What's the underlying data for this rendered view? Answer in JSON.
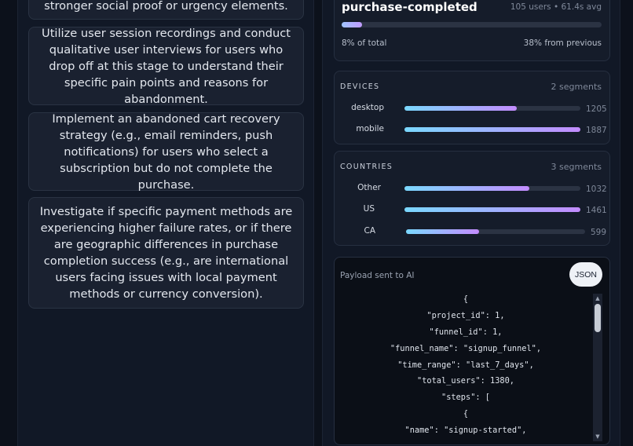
{
  "recommendations": [
    "stronger social proof or urgency elements.",
    "Utilize user session recordings and conduct qualitative user interviews for users who drop off at this stage to understand their specific pain points and reasons for abandonment.",
    "Implement an abandoned cart recovery strategy (e.g., email reminders, push notifications) for users who select a subscription but do not complete the purchase.",
    "Investigate if specific payment methods are experiencing higher failure rates, or if there are geographic differences in purchase completion success (e.g., are international users facing issues with local payment methods or currency conversion)."
  ],
  "step": {
    "name": "purchase-completed",
    "meta": "105 users • 61.4s avg",
    "progress": 0.08,
    "pct_of_total": "8% of total",
    "from_previous": "38% from previous"
  },
  "devices": {
    "title": "DEVICES",
    "count": "2 segments",
    "items": [
      {
        "label": "desktop",
        "value": "1205",
        "fill": 0.64
      },
      {
        "label": "mobile",
        "value": "1887",
        "fill": 1.0
      }
    ]
  },
  "countries": {
    "title": "COUNTRIES",
    "count": "3 segments",
    "items": [
      {
        "label": "Other",
        "value": "1032",
        "fill": 0.71
      },
      {
        "label": "US",
        "value": "1461",
        "fill": 1.0
      },
      {
        "label": "CA",
        "value": "599",
        "fill": 0.41
      }
    ]
  },
  "payload": {
    "label": "Payload sent to AI",
    "button": "JSON",
    "lines": [
      "{",
      "\"project_id\": 1,",
      "\"funnel_id\": 1,",
      "\"funnel_name\": \"signup_funnel\",",
      "\"time_range\": \"last_7_days\",",
      "\"total_users\": 1380,",
      "\"steps\": [",
      "{",
      "\"name\": \"signup-started\","
    ]
  }
}
